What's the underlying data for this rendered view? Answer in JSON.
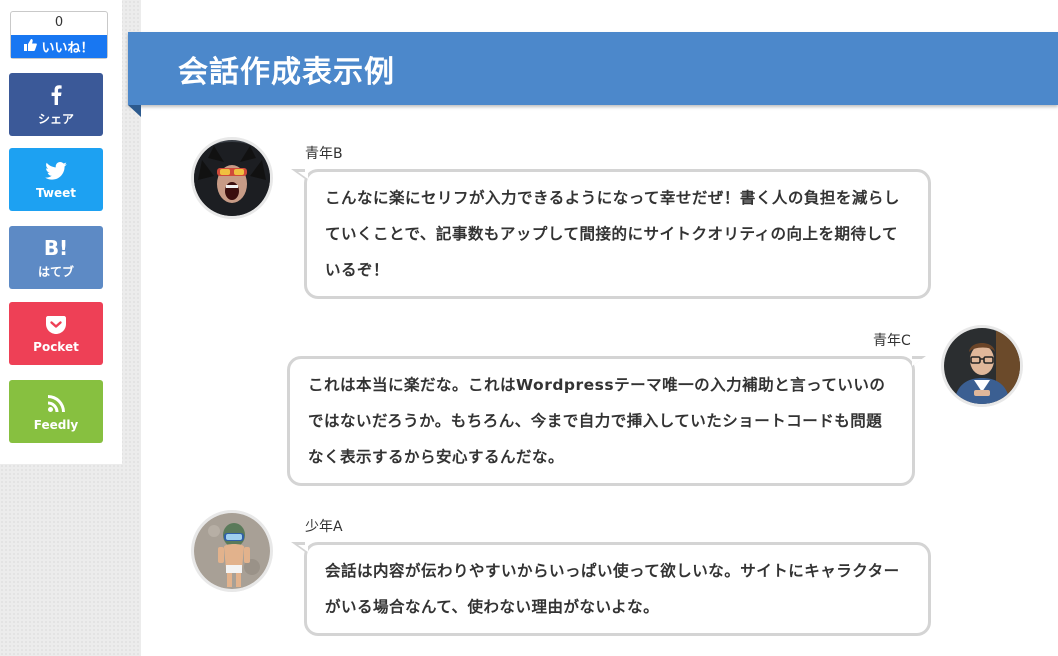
{
  "share": {
    "like_count": "0",
    "like_label": "いいね！",
    "facebook_label": "シェア",
    "twitter_label": "Tweet",
    "hatena_mark": "B!",
    "hatena_label": "はてブ",
    "pocket_label": "Pocket",
    "feedly_label": "Feedly"
  },
  "heading": "会話作成表示例",
  "conversation": [
    {
      "speaker": "青年B",
      "side": "left",
      "text": "こんなに楽にセリフが入力できるようになって幸せだぜ！書く人の負担を減らしていくことで、記事数もアップして間接的にサイトクオリティの向上を期待しているぞ！"
    },
    {
      "speaker": "青年C",
      "side": "right",
      "text": "これは本当に楽だな。これはWordpressテーマ唯一の入力補助と言っていいのではないだろうか。もちろん、今まで自力で挿入していたショートコードも問題なく表示するから安心するんだな。"
    },
    {
      "speaker": "少年A",
      "side": "left",
      "text": "会話は内容が伝わりやすいからいっぱい使って欲しいな。サイトにキャラクターがいる場合なんて、使わない理由がないよな。"
    }
  ],
  "colors": {
    "heading_bg": "#4c88cb",
    "facebook": "#3b5998",
    "twitter": "#1da1f2",
    "hatena": "#5d8ac5",
    "pocket": "#ee4056",
    "feedly": "#87c040",
    "like": "#1877f2"
  }
}
